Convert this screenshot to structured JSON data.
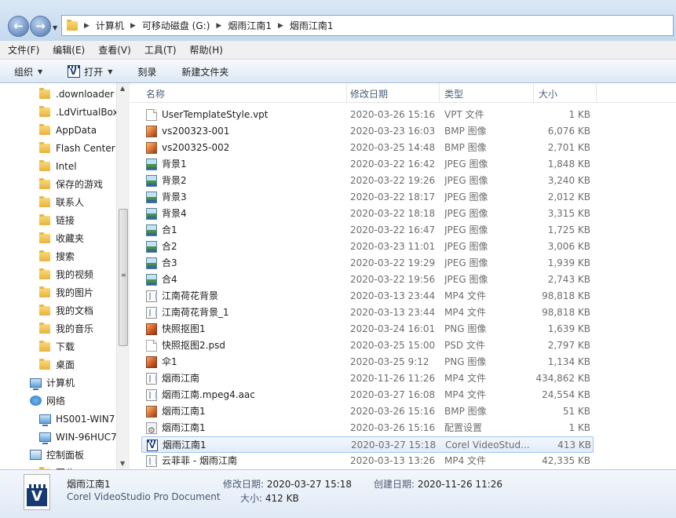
{
  "address": {
    "crumbs": [
      "计算机",
      "可移动磁盘 (G:)",
      "烟雨江南1",
      "烟雨江南1"
    ]
  },
  "menu": [
    "文件(F)",
    "编辑(E)",
    "查看(V)",
    "工具(T)",
    "帮助(H)"
  ],
  "toolbar": {
    "organize": "组织",
    "open": "打开",
    "burn": "刻录",
    "new_folder": "新建文件夹"
  },
  "nav": {
    "folders": [
      ".downloader",
      ".LdVirtualBox",
      "AppData",
      "Flash Center",
      "Intel",
      "保存的游戏",
      "联系人",
      "链接",
      "收藏夹",
      "搜索",
      "我的视频",
      "我的图片",
      "我的文档",
      "我的音乐",
      "下载",
      "桌面"
    ],
    "computer": "计算机",
    "network": "网络",
    "network_items": [
      "HS001-WIN7",
      "WIN-96HUC7"
    ],
    "control_panel": "控制面板",
    "cut_off": "回收"
  },
  "columns": {
    "name": "名称",
    "date": "修改日期",
    "type": "类型",
    "size": "大小"
  },
  "files": [
    {
      "name": "UserTemplateStyle.vpt",
      "date": "2020-03-26 15:16",
      "type": "VPT 文件",
      "size": "1 KB",
      "icon": "doc-icon"
    },
    {
      "name": "vs200323-001",
      "date": "2020-03-23 16:03",
      "type": "BMP 图像",
      "size": "6,076 KB",
      "icon": "bmp-icon"
    },
    {
      "name": "vs200325-002",
      "date": "2020-03-25 14:48",
      "type": "BMP 图像",
      "size": "2,701 KB",
      "icon": "bmp-icon"
    },
    {
      "name": "背景1",
      "date": "2020-03-22 16:42",
      "type": "JPEG 图像",
      "size": "1,848 KB",
      "icon": "jpeg-icon"
    },
    {
      "name": "背景2",
      "date": "2020-03-22 19:26",
      "type": "JPEG 图像",
      "size": "3,240 KB",
      "icon": "jpeg-icon"
    },
    {
      "name": "背景3",
      "date": "2020-03-22 18:17",
      "type": "JPEG 图像",
      "size": "2,012 KB",
      "icon": "jpeg-icon"
    },
    {
      "name": "背景4",
      "date": "2020-03-22 18:18",
      "type": "JPEG 图像",
      "size": "3,315 KB",
      "icon": "jpeg-icon"
    },
    {
      "name": "合1",
      "date": "2020-03-22 16:47",
      "type": "JPEG 图像",
      "size": "1,725 KB",
      "icon": "jpeg-icon"
    },
    {
      "name": "合2",
      "date": "2020-03-23 11:01",
      "type": "JPEG 图像",
      "size": "3,006 KB",
      "icon": "jpeg-icon"
    },
    {
      "name": "合3",
      "date": "2020-03-22 19:29",
      "type": "JPEG 图像",
      "size": "1,939 KB",
      "icon": "jpeg-icon"
    },
    {
      "name": "合4",
      "date": "2020-03-22 19:56",
      "type": "JPEG 图像",
      "size": "2,743 KB",
      "icon": "jpeg-icon"
    },
    {
      "name": "江南荷花背景",
      "date": "2020-03-13 23:44",
      "type": "MP4 文件",
      "size": "98,818 KB",
      "icon": "mp4-icon"
    },
    {
      "name": "江南荷花背景_1",
      "date": "2020-03-13 23:44",
      "type": "MP4 文件",
      "size": "98,818 KB",
      "icon": "mp4-icon"
    },
    {
      "name": "快照抠图1",
      "date": "2020-03-24 16:01",
      "type": "PNG 图像",
      "size": "1,639 KB",
      "icon": "png-icon"
    },
    {
      "name": "快照抠图2.psd",
      "date": "2020-03-25 15:00",
      "type": "PSD 文件",
      "size": "2,797 KB",
      "icon": "psd-icon"
    },
    {
      "name": "伞1",
      "date": "2020-03-25 9:12",
      "type": "PNG 图像",
      "size": "1,134 KB",
      "icon": "png-icon"
    },
    {
      "name": "烟雨江南",
      "date": "2020-11-26 11:26",
      "type": "MP4 文件",
      "size": "434,862 KB",
      "icon": "mp4-icon"
    },
    {
      "name": "烟雨江南.mpeg4.aac",
      "date": "2020-03-27 16:08",
      "type": "MP4 文件",
      "size": "24,554 KB",
      "icon": "mp4-icon"
    },
    {
      "name": "烟雨江南1",
      "date": "2020-03-26 15:16",
      "type": "BMP 图像",
      "size": "51 KB",
      "icon": "bmp-icon"
    },
    {
      "name": "烟雨江南1",
      "date": "2020-03-26 15:16",
      "type": "配置设置",
      "size": "1 KB",
      "icon": "ini-icon"
    },
    {
      "name": "烟雨江南1",
      "date": "2020-03-27 15:18",
      "type": "Corel VideoStud...",
      "size": "413 KB",
      "icon": "videostudio-icon",
      "selected": true
    },
    {
      "name": "云菲菲 - 烟雨江南",
      "date": "2020-03-13 13:26",
      "type": "MP4 文件",
      "size": "42,335 KB",
      "icon": "mp4-icon"
    }
  ],
  "details": {
    "name": "烟雨江南1",
    "type": "Corel VideoStudio Pro Document",
    "modified_label": "修改日期:",
    "modified_value": "2020-03-27 15:18",
    "created_label": "创建日期:",
    "created_value": "2020-11-26 11:26",
    "size_label": "大小:",
    "size_value": "412 KB"
  }
}
